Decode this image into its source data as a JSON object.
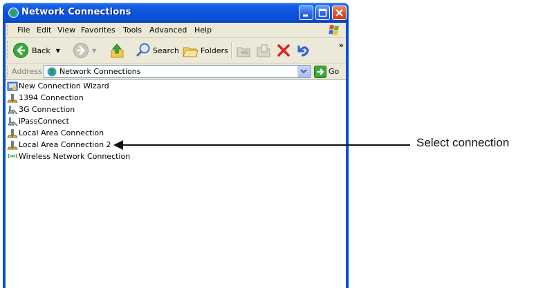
{
  "window": {
    "title": "Network Connections"
  },
  "menu": [
    "File",
    "Edit",
    "View",
    "Favorites",
    "Tools",
    "Advanced",
    "Help"
  ],
  "toolbar": {
    "back_label": "Back",
    "search_label": "Search",
    "folders_label": "Folders",
    "more": "»"
  },
  "address": {
    "label": "Address",
    "value": "Network Connections",
    "go_label": "Go"
  },
  "connections": [
    {
      "label": "New Connection Wizard",
      "icon": "wizard-icon"
    },
    {
      "label": "1394 Connection",
      "icon": "lan-icon"
    },
    {
      "label": "3G Connection",
      "icon": "dialup-icon"
    },
    {
      "label": "iPassConnect",
      "icon": "dialup-icon"
    },
    {
      "label": "Local Area Connection",
      "icon": "lan-icon"
    },
    {
      "label": "Local Area Connection 2",
      "icon": "lan-icon"
    },
    {
      "label": "Wireless Network Connection",
      "icon": "wireless-icon"
    }
  ],
  "annotation": {
    "text": "Select connection"
  },
  "colors": {
    "titlebar": "#0a52dc",
    "close": "#d8532b",
    "background": "#ece9d8"
  }
}
